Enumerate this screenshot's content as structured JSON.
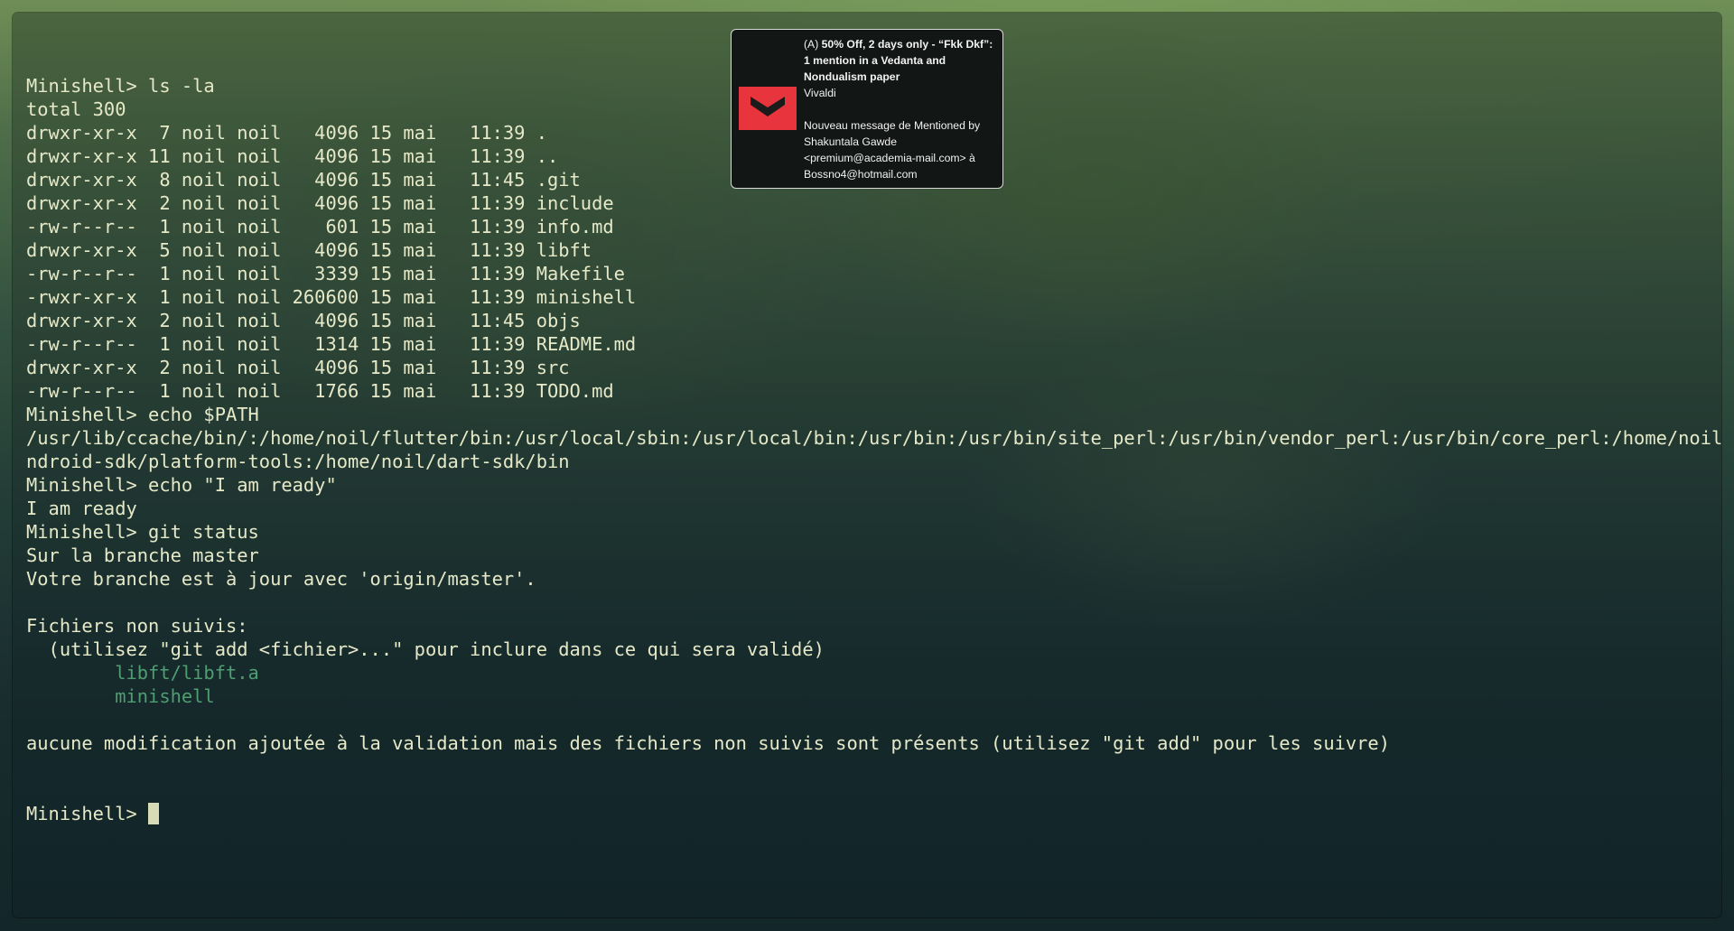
{
  "terminal": {
    "lines": [
      "Minishell> ls -la",
      "total 300",
      "drwxr-xr-x  7 noil noil   4096 15 mai   11:39 .",
      "drwxr-xr-x 11 noil noil   4096 15 mai   11:39 ..",
      "drwxr-xr-x  8 noil noil   4096 15 mai   11:45 .git",
      "drwxr-xr-x  2 noil noil   4096 15 mai   11:39 include",
      "-rw-r--r--  1 noil noil    601 15 mai   11:39 info.md",
      "drwxr-xr-x  5 noil noil   4096 15 mai   11:39 libft",
      "-rw-r--r--  1 noil noil   3339 15 mai   11:39 Makefile",
      "-rwxr-xr-x  1 noil noil 260600 15 mai   11:39 minishell",
      "drwxr-xr-x  2 noil noil   4096 15 mai   11:45 objs",
      "-rw-r--r--  1 noil noil   1314 15 mai   11:39 README.md",
      "drwxr-xr-x  2 noil noil   4096 15 mai   11:39 src",
      "-rw-r--r--  1 noil noil   1766 15 mai   11:39 TODO.md",
      "Minishell> echo $PATH",
      "/usr/lib/ccache/bin/:/home/noil/flutter/bin:/usr/local/sbin:/usr/local/bin:/usr/bin:/usr/bin/site_perl:/usr/bin/vendor_perl:/usr/bin/core_perl:/home/noil/a",
      "ndroid-sdk/platform-tools:/home/noil/dart-sdk/bin",
      "Minishell> echo \"I am ready\"",
      "I am ready",
      "Minishell> git status",
      "Sur la branche master",
      "Votre branche est à jour avec 'origin/master'.",
      "",
      "Fichiers non suivis:",
      "  (utilisez \"git add <fichier>...\" pour inclure dans ce qui sera validé)",
      "        libft/libft.a",
      "        minishell",
      "",
      "aucune modification ajoutée à la validation mais des fichiers non suivis sont présents (utilisez \"git add\" pour les suivre)"
    ],
    "untracked_line_indexes": [
      25,
      26
    ],
    "prompt": "Minishell> ",
    "colors": {
      "text": "#e6e9c8",
      "untracked": "#4f9e72",
      "cursor": "#d7dcb6"
    }
  },
  "notification": {
    "tag": "(A) ",
    "title": "50% Off, 2 days only - “Fkk Dkf”: 1 mention in a Vedanta and Nondualism paper",
    "app": "Vivaldi",
    "body": "Nouveau message de Mentioned by Shakuntala Gawde <premium@academia-mail.com> à Bossno4@hotmail.com",
    "icon": "email-chevron-icon",
    "icon_color": "#e8343c"
  }
}
